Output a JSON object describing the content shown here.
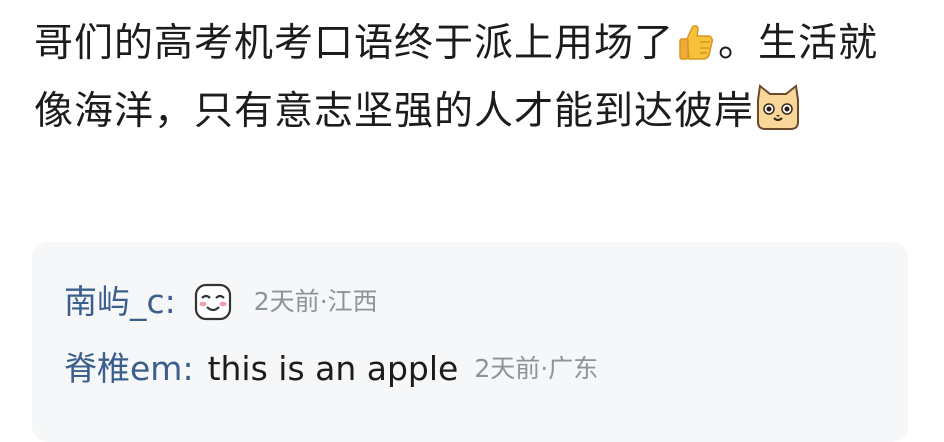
{
  "post": {
    "text_part1": "哥们的高考机考口语终于派上用场了",
    "text_part2": "。生活就像海洋，只有意志坚强的人才能到达彼岸",
    "emoji_1": "thumbs-up-icon",
    "emoji_2": "cat-face-icon"
  },
  "replies": [
    {
      "username": "南屿_c",
      "colon": ":",
      "text": "",
      "icon": "smiling-face-icon",
      "time": "2天前",
      "separator": "·",
      "location": "江西"
    },
    {
      "username": "脊椎em",
      "colon": ":",
      "text": "this is an apple",
      "time": "2天前",
      "separator": "·",
      "location": "广东"
    }
  ],
  "colors": {
    "username": "#3b5f8c",
    "meta": "#8e9399",
    "reply_bg": "#f6f7f9"
  }
}
